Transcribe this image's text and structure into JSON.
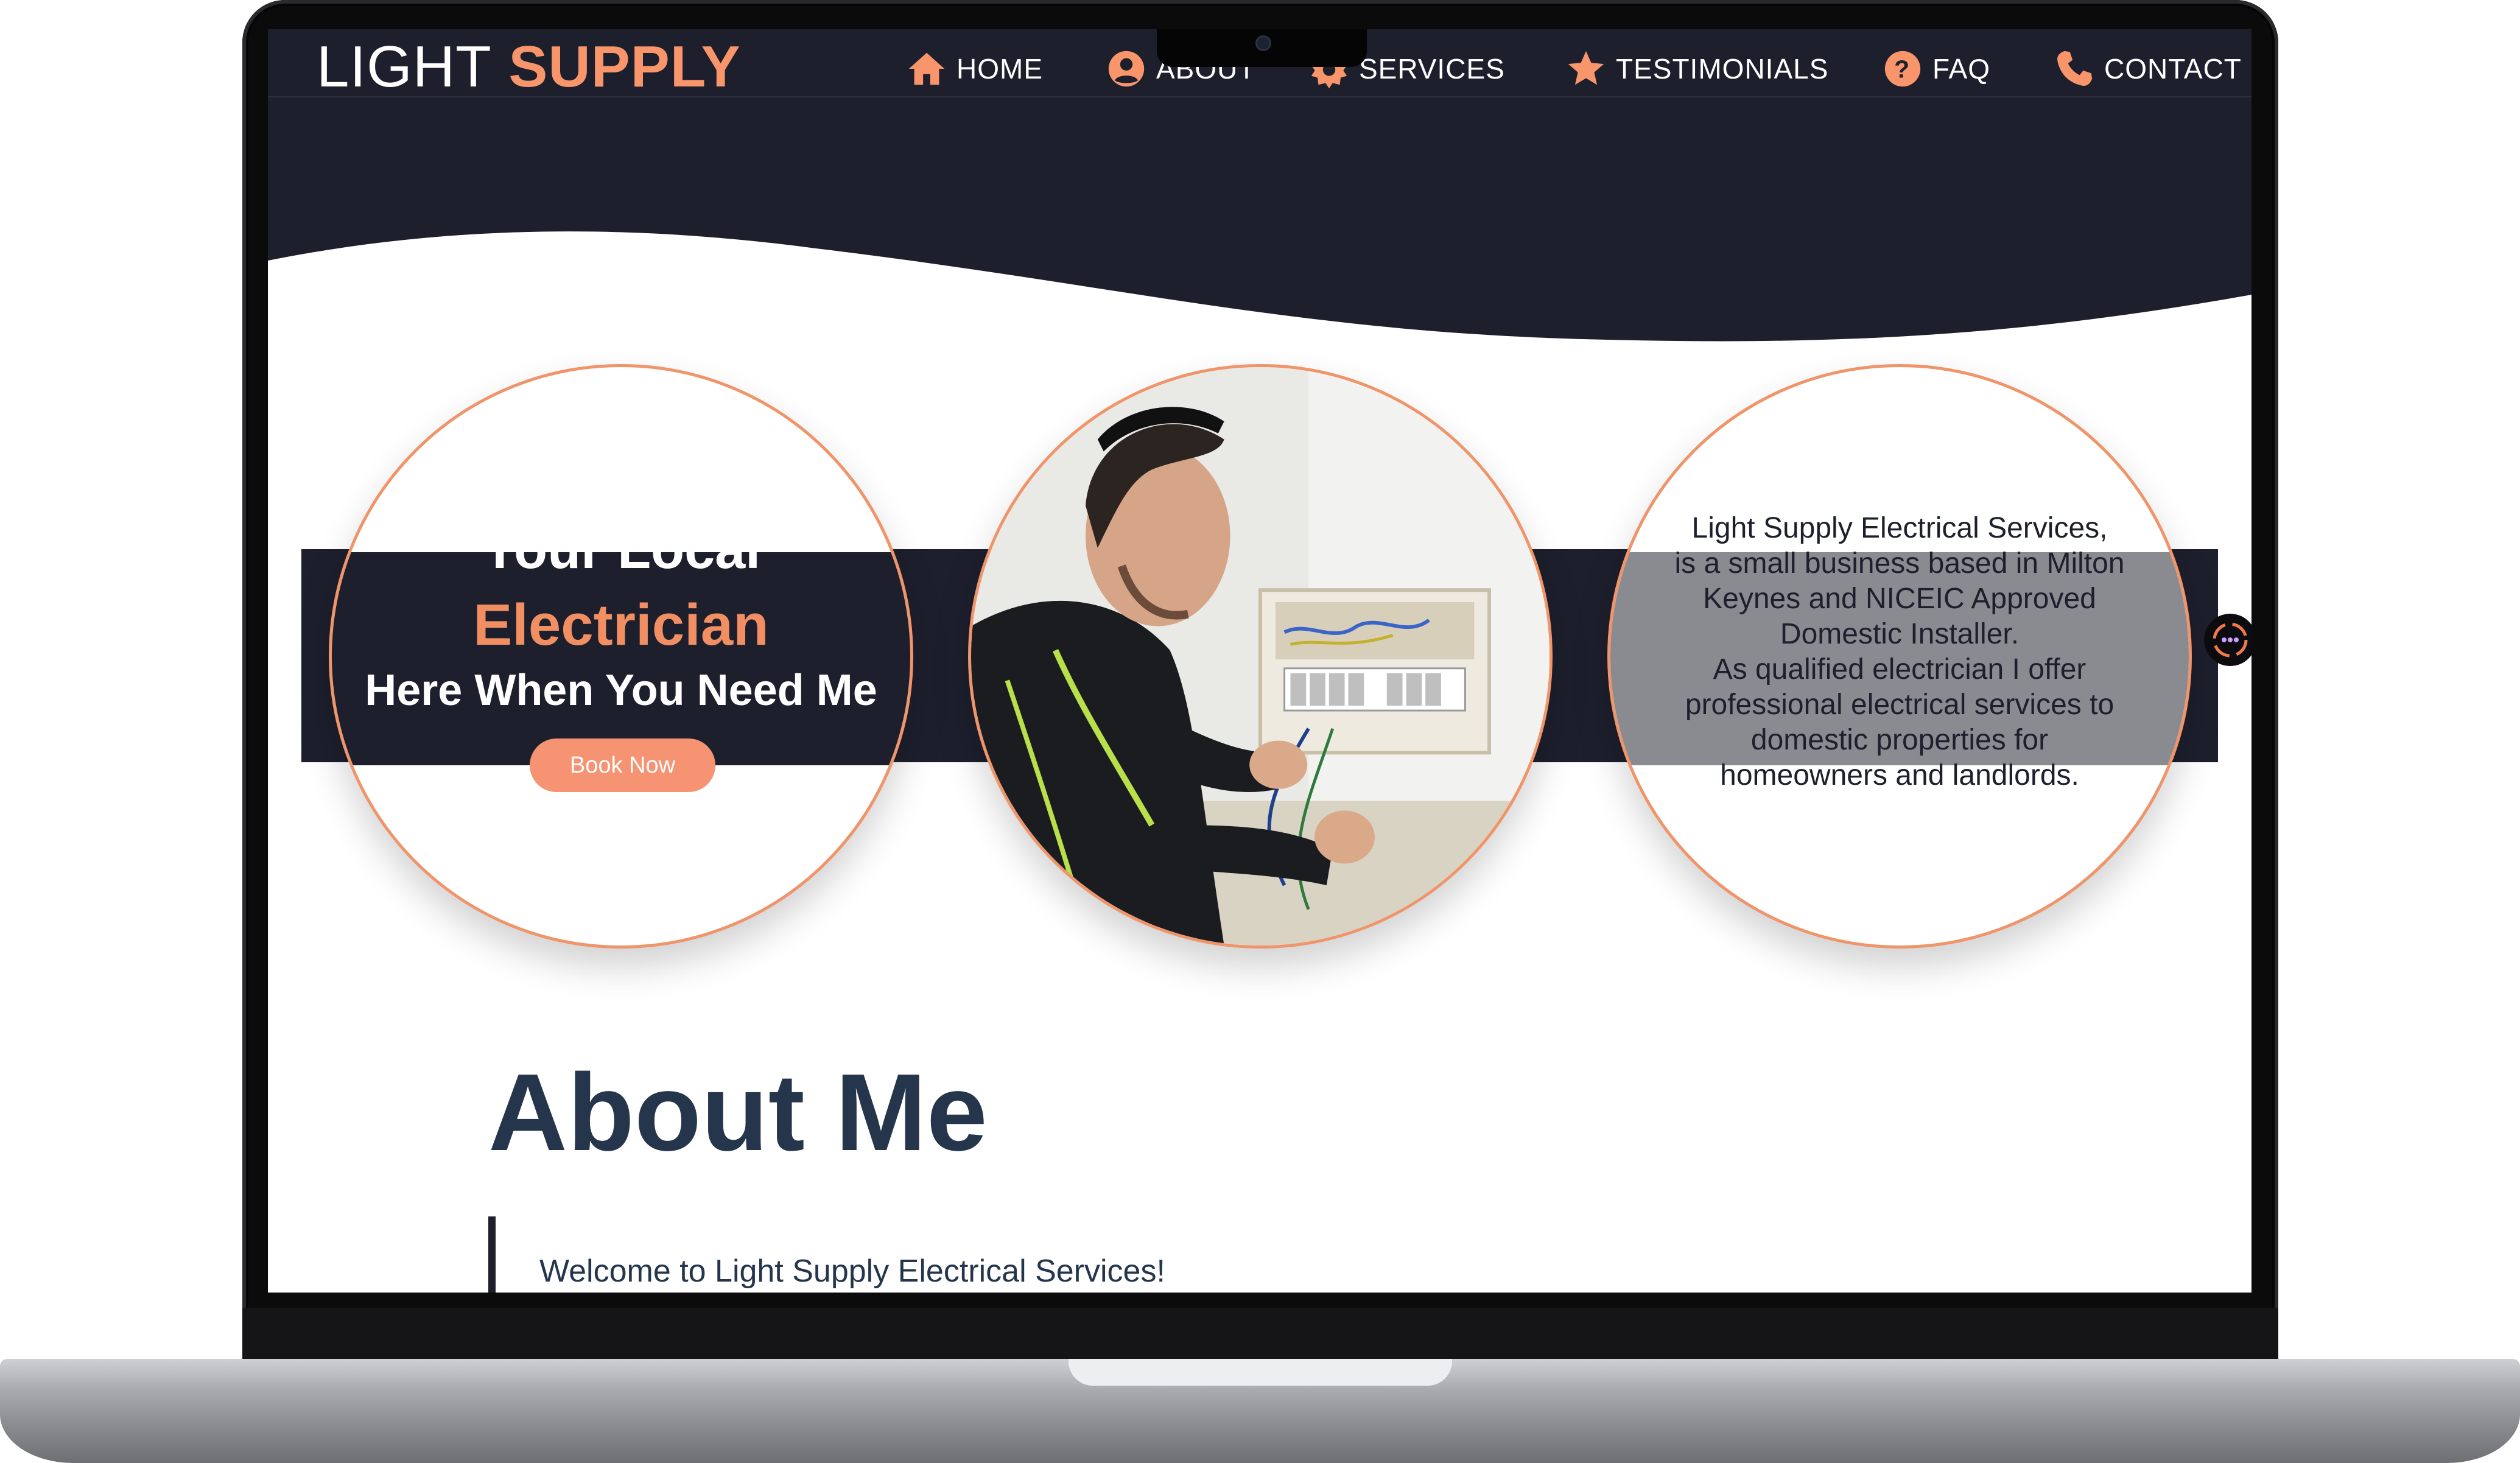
{
  "logo": {
    "light": "LIGHT",
    "supply": "SUPPLY"
  },
  "nav": [
    {
      "label": "HOME",
      "icon": "home-icon"
    },
    {
      "label": "ABOUT",
      "icon": "user-circle-icon"
    },
    {
      "label": "SERVICES",
      "icon": "gear-icon"
    },
    {
      "label": "TESTIMONIALS",
      "icon": "star-icon"
    },
    {
      "label": "FAQ",
      "icon": "question-circle-icon"
    },
    {
      "label": "CONTACT",
      "icon": "phone-icon"
    }
  ],
  "hero": {
    "line1": "Your Local",
    "line2": "Electrician",
    "line3": "Here When You Need Me",
    "button": "Book Now"
  },
  "intro": {
    "lines": [
      "Light Supply Electrical Services,",
      "is a small business based in Milton",
      "Keynes and NICEIC Approved",
      "Domestic Installer.",
      "As qualified electrician I offer",
      "professional electrical services to",
      "domestic properties for",
      "homeowners and landlords."
    ]
  },
  "about": {
    "title": "About Me",
    "welcome": "Welcome to Light Supply Electrical Services!"
  },
  "colors": {
    "navy": "#1d1f2d",
    "accent": "#f8956a",
    "heading": "#25354b"
  }
}
